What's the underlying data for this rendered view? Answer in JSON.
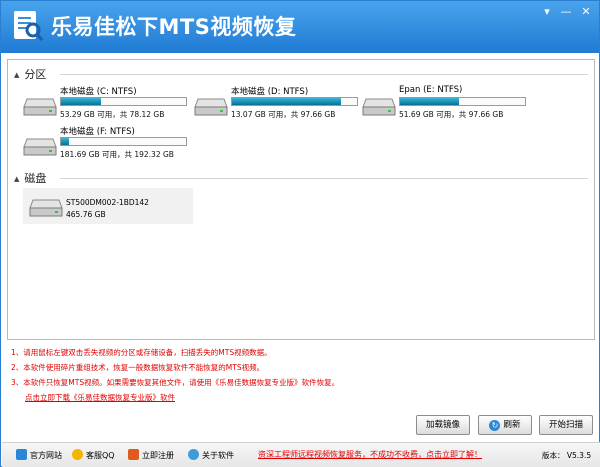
{
  "app": {
    "title": "乐易佳松下MTS视频恢复"
  },
  "window_controls": {
    "menu": "▾",
    "minimize": "—",
    "close": "✕"
  },
  "partitions": {
    "title": "分区",
    "items": [
      {
        "name": "本地磁盘 (C: NTFS)",
        "usage": "53.29 GB 可用，共 78.12 GB",
        "used_fraction": 0.32
      },
      {
        "name": "本地磁盘 (D: NTFS)",
        "usage": "13.07 GB 可用，共 97.66 GB",
        "used_fraction": 0.87
      },
      {
        "name": "Epan (E: NTFS)",
        "usage": "51.69 GB 可用，共 97.66 GB",
        "used_fraction": 0.47
      },
      {
        "name": "本地磁盘 (F: NTFS)",
        "usage": "181.69 GB 可用，共 192.32 GB",
        "used_fraction": 0.06
      }
    ]
  },
  "disks": {
    "title": "磁盘",
    "items": [
      {
        "name": "ST500DM002-1BD142",
        "size": "465.76 GB"
      }
    ]
  },
  "notes": {
    "line1": "1、请用鼠标左键双击丢失视频的分区或存储设备，扫描丢失的MTS视频数据。",
    "line2": "2、本软件使用碎片重组技术，恢复一般数据恢复软件不能恢复的MTS视频。",
    "line3": "3、本软件只恢复MTS视频。如果需要恢复其他文件，请使用《乐易佳数据恢复专业版》软件恢复。",
    "download_link": "点击立即下载《乐易佳数据恢复专业版》软件"
  },
  "buttons": {
    "load_image": "加载镜像",
    "refresh": "刷新",
    "start_scan": "开始扫描"
  },
  "footer": {
    "website": "官方网站",
    "qq": "客服QQ",
    "register": "立即注册",
    "about": "关于软件",
    "promo": "资深工程师远程视频恢复服务，不成功不收费，点击立即了解！",
    "version": "版本： V5.3.5"
  },
  "colors": {
    "title_bar": "#1f7bd4",
    "bar_fill": "#0b6e96",
    "note_red": "#e00000"
  },
  "icons": [
    "app-logo-icon",
    "hard-drive-icon",
    "refresh-icon",
    "scan-icon",
    "home-icon",
    "qq-icon",
    "register-icon",
    "about-icon"
  ]
}
